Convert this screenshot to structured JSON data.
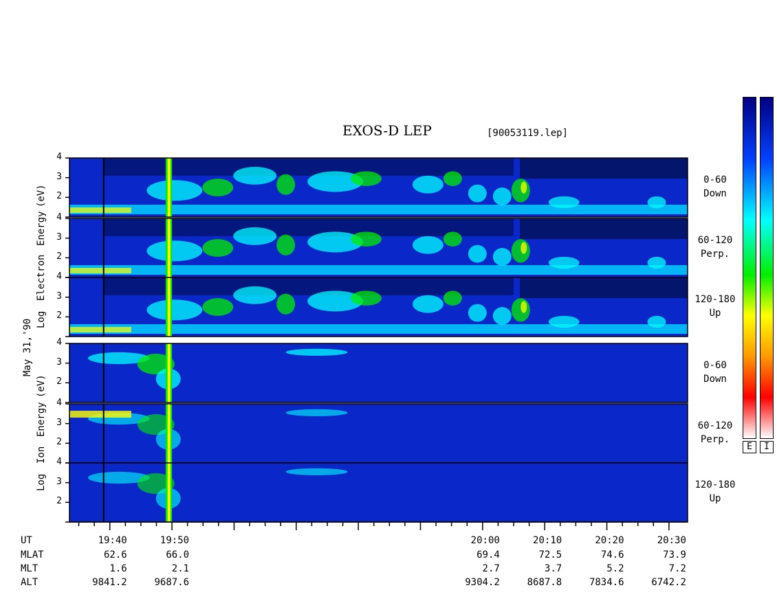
{
  "chart_data": {
    "type": "heatmap",
    "title": "EXOS-D LEP",
    "file_tag": "[90053119.lep]",
    "date_label": "May 31,'90",
    "electron_axis_label": [
      "Log",
      "Electron",
      "Energy",
      "(eV)"
    ],
    "ion_axis_label": [
      "Log",
      "Ion",
      "Energy",
      "(eV)"
    ],
    "y_ticks": [
      "4",
      "3",
      "2"
    ],
    "ylim": [
      1,
      4
    ],
    "panels": [
      {
        "species": "Electron",
        "pitch_range": "0-60",
        "direction": "Down"
      },
      {
        "species": "Electron",
        "pitch_range": "60-120",
        "direction": "Perp."
      },
      {
        "species": "Electron",
        "pitch_range": "120-180",
        "direction": "Up"
      },
      {
        "species": "Ion",
        "pitch_range": "0-60",
        "direction": "Down"
      },
      {
        "species": "Ion",
        "pitch_range": "60-120",
        "direction": "Perp."
      },
      {
        "species": "Ion",
        "pitch_range": "120-180",
        "direction": "Up"
      }
    ],
    "x_rows": [
      {
        "label": "UT",
        "values": [
          "19:40",
          "19:50",
          "20:00",
          "20:10",
          "20:20",
          "20:30"
        ]
      },
      {
        "label": "MLAT",
        "values": [
          "62.6",
          "66.0",
          "69.4",
          "72.5",
          "74.6",
          "73.9"
        ]
      },
      {
        "label": "MLT",
        "values": [
          "1.6",
          "2.1",
          "2.7",
          "3.7",
          "5.2",
          "7.2"
        ]
      },
      {
        "label": "ALT",
        "values": [
          "9841.2",
          "9687.6",
          "9304.2",
          "8687.8",
          "7834.6",
          "6742.2"
        ]
      }
    ],
    "ut_range_minutes": [
      1933.5,
      2033
    ],
    "colorbars": [
      {
        "label": "E"
      },
      {
        "label": "I"
      }
    ],
    "colorscale": [
      "#ffffff",
      "#ff0000",
      "#ffff00",
      "#00ff00",
      "#00ffff",
      "#0000ff",
      "#000080"
    ],
    "background_color": "#0a28c8"
  }
}
